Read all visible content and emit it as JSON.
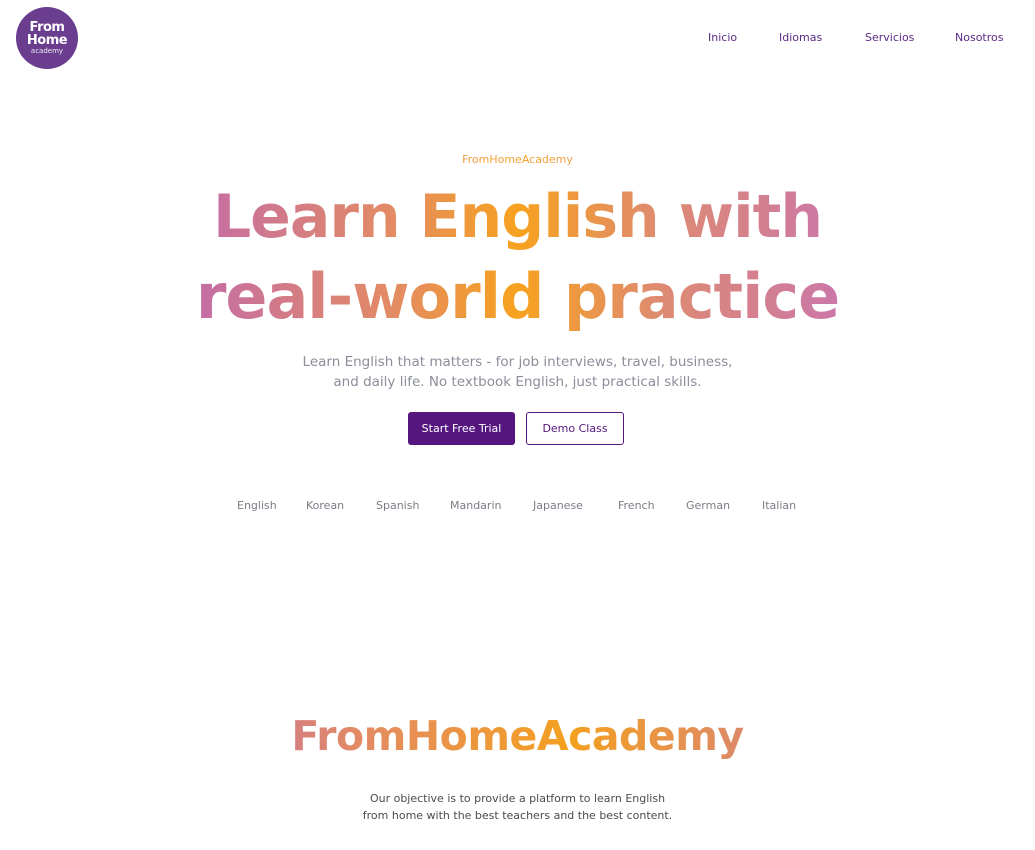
{
  "logo": {
    "line1": "From",
    "line2": "Home",
    "line3": "academy"
  },
  "nav": {
    "items": [
      "Inicio",
      "Idiomas",
      "Servicios",
      "Nosotros"
    ]
  },
  "hero": {
    "eyebrow": "FromHomeAcademy",
    "headline_line1": "Learn English with",
    "headline_line2": "real-world practice",
    "subtitle_line1": "Learn English that matters - for job interviews, travel, business,",
    "subtitle_line2": "and daily life. No textbook English, just practical skills.",
    "primary_button": "Start Free Trial",
    "secondary_button": "Demo Class"
  },
  "languages": [
    "English",
    "Korean",
    "Spanish",
    "Mandarin",
    "Japanese",
    "French",
    "German",
    "Italian"
  ],
  "about": {
    "title": "FromHomeAcademy",
    "text_line1": "Our objective is to provide a platform to learn English",
    "text_line2": "from home with the best teachers and the best content."
  },
  "colors": {
    "brand_purple": "#55177f",
    "logo_bg": "#6a3d8f",
    "gradient_purple": "#a64fe8",
    "gradient_orange": "#f7a21f"
  }
}
